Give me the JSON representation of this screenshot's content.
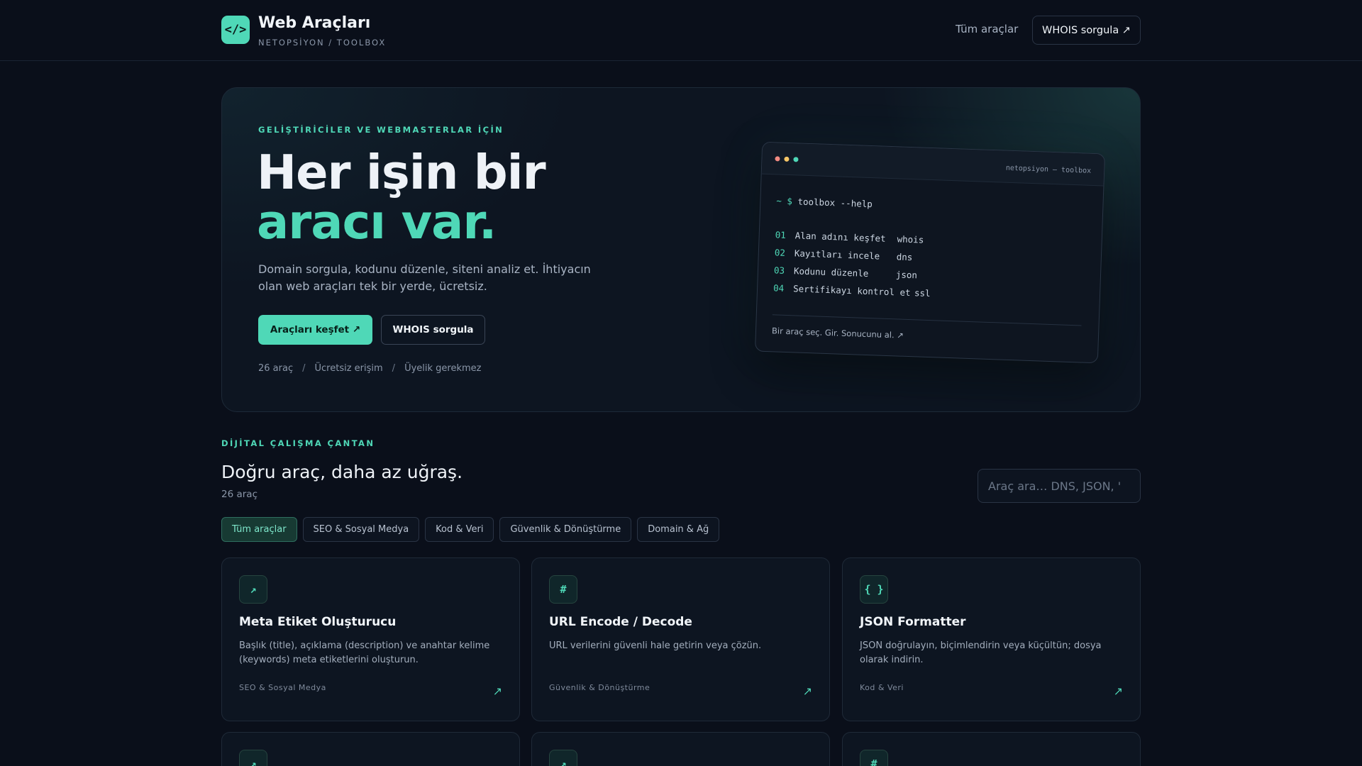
{
  "header": {
    "logo_text": "</>",
    "title": "Web Araçları",
    "subtitle": "NETOPSİYON / TOOLBOX",
    "nav_all_tools": "Tüm araçlar",
    "nav_whois": "WHOIS sorgula ↗"
  },
  "hero": {
    "eyebrow": "GELİŞTİRİCİLER VE WEBMASTERLAR İÇİN",
    "title_line1": "Her işin bir",
    "title_line2": "aracı var.",
    "description": "Domain sorgula, kodunu düzenle, siteni analiz et. İhtiyacın olan web araçları tek bir yerde, ücretsiz.",
    "primary_button": "Araçları keşfet ↗",
    "secondary_button": "WHOIS sorgula",
    "meta": [
      "26 araç",
      "Ücretsiz erişim",
      "Üyelik gerekmez"
    ],
    "meta_separator": "/"
  },
  "terminal": {
    "title": "netopsiyon — toolbox",
    "prompt": "~ $",
    "command": "toolbox --help",
    "rows": [
      {
        "num": "01",
        "label": "Alan adını keşfet",
        "cmd": "whois"
      },
      {
        "num": "02",
        "label": "Kayıtları incele",
        "cmd": "dns"
      },
      {
        "num": "03",
        "label": "Kodunu düzenle",
        "cmd": "json"
      },
      {
        "num": "04",
        "label": "Sertifikayı kontrol et",
        "cmd": "ssl"
      }
    ],
    "footer": "Bir araç seç. Gir. Sonucunu al. ↗",
    "dot_colors": [
      "#f28b82",
      "#f6c667",
      "#4fd8b7"
    ]
  },
  "tools_section": {
    "eyebrow": "DİJİTAL ÇALIŞMA ÇANTAN",
    "title": "Doğru araç, daha az uğraş.",
    "count": "26 araç",
    "search_placeholder": "Araç ara… DNS, JSON, '",
    "filters": [
      "Tüm araçlar",
      "SEO & Sosyal Medya",
      "Kod & Veri",
      "Güvenlik & Dönüştürme",
      "Domain & Ağ"
    ],
    "active_filter": "Tüm araçlar"
  },
  "cards": [
    {
      "icon": "↗",
      "icon_name": "arrow-icon",
      "title": "Meta Etiket Oluşturucu",
      "desc": "Başlık (title), açıklama (description) ve anahtar kelime (keywords) meta etiketlerini oluşturun.",
      "category": "SEO & Sosyal Medya",
      "arrow": "↗"
    },
    {
      "icon": "#",
      "icon_name": "hash-icon",
      "title": "URL Encode / Decode",
      "desc": "URL verilerini güvenli hale getirin veya çözün.",
      "category": "Güvenlik & Dönüştürme",
      "arrow": "↗"
    },
    {
      "icon": "{ }",
      "icon_name": "braces-icon",
      "title": "JSON Formatter",
      "desc": "JSON doğrulayın, biçimlendirin veya küçültün; dosya olarak indirin.",
      "category": "Kod & Veri",
      "arrow": "↗"
    }
  ],
  "partial_cards": [
    {
      "icon": "↗",
      "icon_name": "arrow-icon"
    },
    {
      "icon": "↗",
      "icon_name": "arrow-icon"
    },
    {
      "icon": "#",
      "icon_name": "hash-icon"
    }
  ],
  "colors": {
    "accent": "#4fd8b7",
    "background": "#0a0f1a"
  }
}
